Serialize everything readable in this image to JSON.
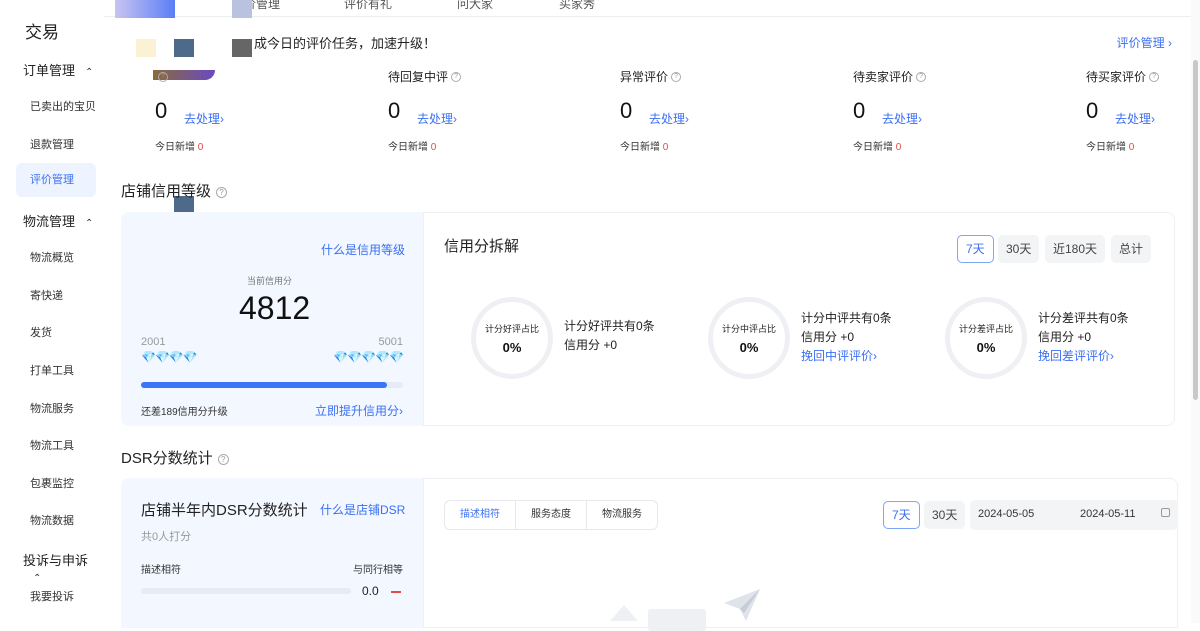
{
  "sidebar": {
    "title": "交易",
    "groups": [
      {
        "label": "订单管理",
        "items": [
          "已卖出的宝贝",
          "退款管理",
          "评价管理"
        ]
      },
      {
        "label": "物流管理",
        "items": [
          "物流概览",
          "寄快递",
          "发货",
          "打单工具",
          "物流服务",
          "物流工具",
          "包裹监控",
          "物流数据"
        ]
      },
      {
        "label": "投诉与申诉",
        "items": [
          "我要投诉"
        ]
      }
    ],
    "active_item": "评价管理"
  },
  "topbar": {
    "tabs": [
      "价管理",
      "评价有礼",
      "问大家",
      "买家秀"
    ]
  },
  "notice": {
    "text": "成今日的评价任务，加速升级！",
    "link": "评价管理 ›"
  },
  "stats": [
    {
      "label": "",
      "count": "0",
      "action": "去处理›",
      "today_label": "今日新增",
      "today_value": "0"
    },
    {
      "label": "待回复中评",
      "count": "0",
      "action": "去处理›",
      "today_label": "今日新增",
      "today_value": "0"
    },
    {
      "label": "异常评价",
      "count": "0",
      "action": "去处理›",
      "today_label": "今日新增",
      "today_value": "0"
    },
    {
      "label": "待卖家评价",
      "count": "0",
      "action": "去处理›",
      "today_label": "今日新增",
      "today_value": "0"
    },
    {
      "label": "待买家评价",
      "count": "0",
      "action": "去处理›",
      "today_label": "今日新增",
      "today_value": "0"
    }
  ],
  "credit": {
    "section_title": "店铺信用等级",
    "what_link": "什么是信用等级",
    "current_label": "当前信用分",
    "score": "4812",
    "range_low": "2001",
    "range_high": "5001",
    "progress_fraction": 0.94,
    "gap_text": "还差189信用分升级",
    "upgrade_link": "立即提升信用分›",
    "breakdown_title": "信用分拆解",
    "periods": [
      "7天",
      "30天",
      "近180天",
      "总计"
    ],
    "active_period": "7天",
    "rings": [
      {
        "label": "计分好评占比",
        "value": "0%",
        "line1": "计分好评共有0条",
        "line2": "信用分 +0",
        "link": ""
      },
      {
        "label": "计分中评占比",
        "value": "0%",
        "line1": "计分中评共有0条",
        "line2": "信用分 +0",
        "link": "挽回中评评价›"
      },
      {
        "label": "计分差评占比",
        "value": "0%",
        "line1": "计分差评共有0条",
        "line2": "信用分 +0",
        "link": "挽回差评评价›"
      }
    ]
  },
  "dsr": {
    "section_title": "DSR分数统计",
    "panel_title": "店铺半年内DSR分数统计",
    "what_link": "什么是店铺DSR",
    "sub": "共0人打分",
    "metric_label": "描述相符",
    "compare_label": "与同行相等",
    "metric_value": "0.0",
    "tabs": [
      "描述相符",
      "服务态度",
      "物流服务"
    ],
    "periods": [
      "7天",
      "30天"
    ],
    "date_from": "2024-05-05",
    "date_to": "2024-05-11"
  },
  "colors": {
    "accent": "#3b6ff5",
    "alert": "#e5484d",
    "panel_bg": "#f3f7ff"
  }
}
